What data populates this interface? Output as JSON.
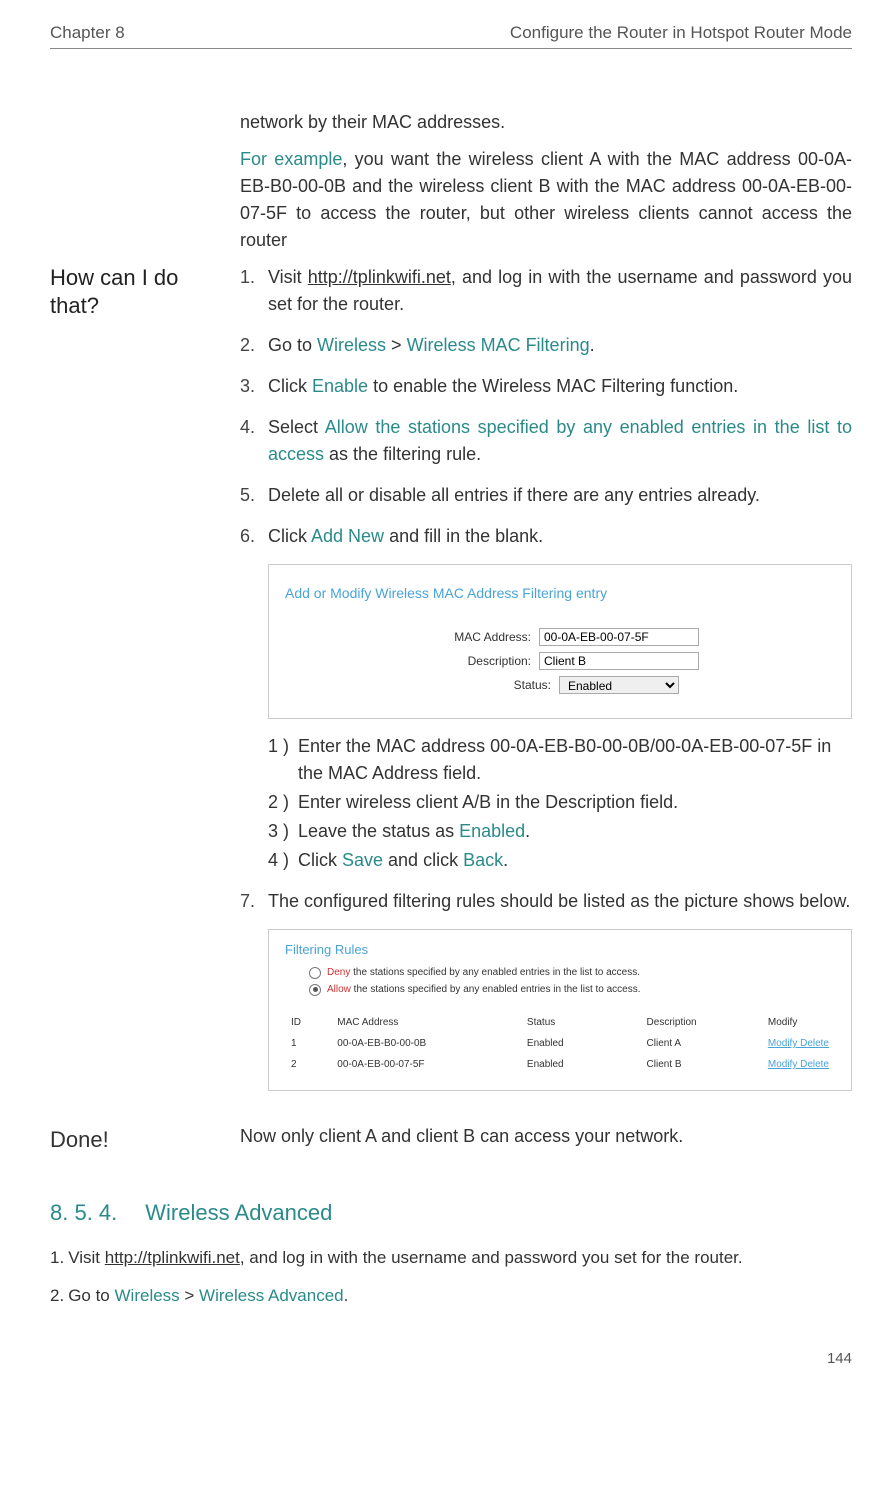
{
  "header": {
    "chapter": "Chapter 8",
    "title": "Configure the Router in Hotspot Router Mode"
  },
  "preface": {
    "line1": "network by their MAC addresses.",
    "example_label": "For example",
    "example_text": ", you want the wireless client A with the MAC address 00-0A-EB-B0-00-0B and the wireless client B with the MAC address 00-0A-EB-00-07-5F to access the router, but other wireless clients cannot access the router"
  },
  "left_heading": "How can I do that?",
  "steps": [
    {
      "n": "1.",
      "pre": "Visit ",
      "link": "http://tplinkwifi.net",
      "post": ", and log in with the username and password you set for the router."
    },
    {
      "n": "2.",
      "pre": "Go to ",
      "t1": "Wireless",
      "sep": " > ",
      "t2": "Wireless MAC Filtering",
      "post": "."
    },
    {
      "n": "3.",
      "pre": "Click ",
      "t1": "Enable",
      "post": " to enable the Wireless MAC Filtering function."
    },
    {
      "n": "4.",
      "pre": "Select ",
      "t1": "Allow the stations specified by any enabled entries in the list to access",
      "post": " as the filtering rule."
    },
    {
      "n": "5.",
      "txt": "Delete all or disable all entries if there are any entries already."
    },
    {
      "n": "6.",
      "pre": "Click ",
      "t1": "Add New",
      "post": " and fill in the blank."
    }
  ],
  "shot1": {
    "title": "Add or Modify Wireless MAC Address Filtering entry",
    "mac_lbl": "MAC Address:",
    "mac_val": "00-0A-EB-00-07-5F",
    "desc_lbl": "Description:",
    "desc_val": "Client B",
    "stat_lbl": "Status:",
    "stat_val": "Enabled"
  },
  "sub": [
    {
      "n": "1 )",
      "txt": "Enter the MAC address 00-0A-EB-B0-00-0B/00-0A-EB-00-07-5F in the MAC Address field."
    },
    {
      "n": "2 )",
      "txt": "Enter wireless client A/B in the Description field."
    },
    {
      "n": "3 )",
      "pre": "Leave the status as ",
      "t1": "Enabled",
      "post": "."
    },
    {
      "n": "4 )",
      "pre": "Click ",
      "t1": "Save",
      "mid": " and click ",
      "t2": "Back",
      "post": "."
    }
  ],
  "step7": {
    "n": "7.",
    "txt": "The configured filtering rules should be listed as the picture shows below."
  },
  "shot2": {
    "title": "Filtering Rules",
    "deny_pre": "Deny",
    "deny_txt": " the stations specified by any enabled entries in the list to access.",
    "allow_pre": "Allow",
    "allow_txt": " the stations specified by any enabled entries in the list to access.",
    "h_id": "ID",
    "h_mac": "MAC Address",
    "h_stat": "Status",
    "h_desc": "Description",
    "h_mod": "Modify",
    "rows": [
      {
        "id": "1",
        "mac": "00-0A-EB-B0-00-0B",
        "stat": "Enabled",
        "desc": "Client A",
        "mod": "Modify Delete"
      },
      {
        "id": "2",
        "mac": "00-0A-EB-00-07-5F",
        "stat": "Enabled",
        "desc": "Client B",
        "mod": "Modify Delete"
      }
    ]
  },
  "done": {
    "label": "Done!",
    "text": "Now only client A and client B can access your network."
  },
  "section": {
    "num": "8. 5. 4.",
    "title": "Wireless Advanced"
  },
  "bottom": [
    {
      "n": "1.",
      "pre": "Visit ",
      "link": "http://tplinkwifi.net",
      "post": ", and log in with the username and password you set for the router."
    },
    {
      "n": "2.",
      "pre": "Go to ",
      "t1": "Wireless",
      "sep": " > ",
      "t2": "Wireless Advanced",
      "post": "."
    }
  ],
  "page": "144"
}
